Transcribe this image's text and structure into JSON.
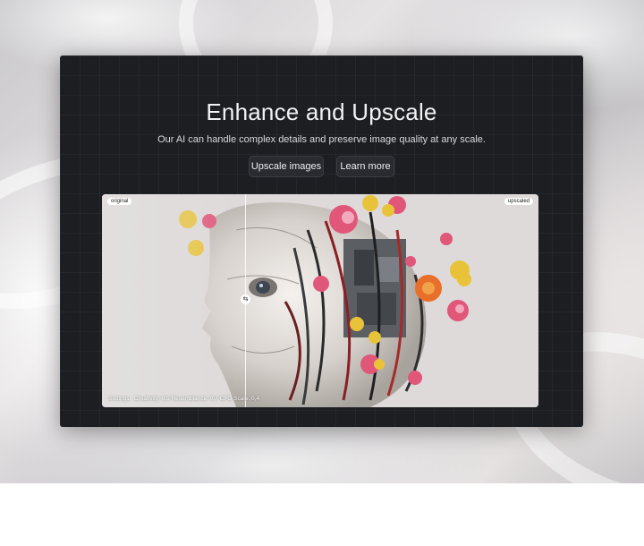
{
  "hero": {
    "title": "Enhance and Upscale",
    "subtitle": "Our AI can handle complex details and preserve image quality at any scale."
  },
  "buttons": {
    "upscale_label": "Upscale images",
    "learn_label": "Learn more"
  },
  "comparison": {
    "original_label": "original",
    "upscaled_label": "upscaled",
    "handle_icon": "swap-arrows-icon",
    "settings_text": "Settings:  Creativity: 0,5 Resemblance: 0,7 CFG Scale: 0,4"
  },
  "colors": {
    "panel_bg": "#1d1e22",
    "flower_pink": "#e0577a",
    "flower_yellow": "#e8c33a",
    "flower_orange": "#e86f2a"
  }
}
